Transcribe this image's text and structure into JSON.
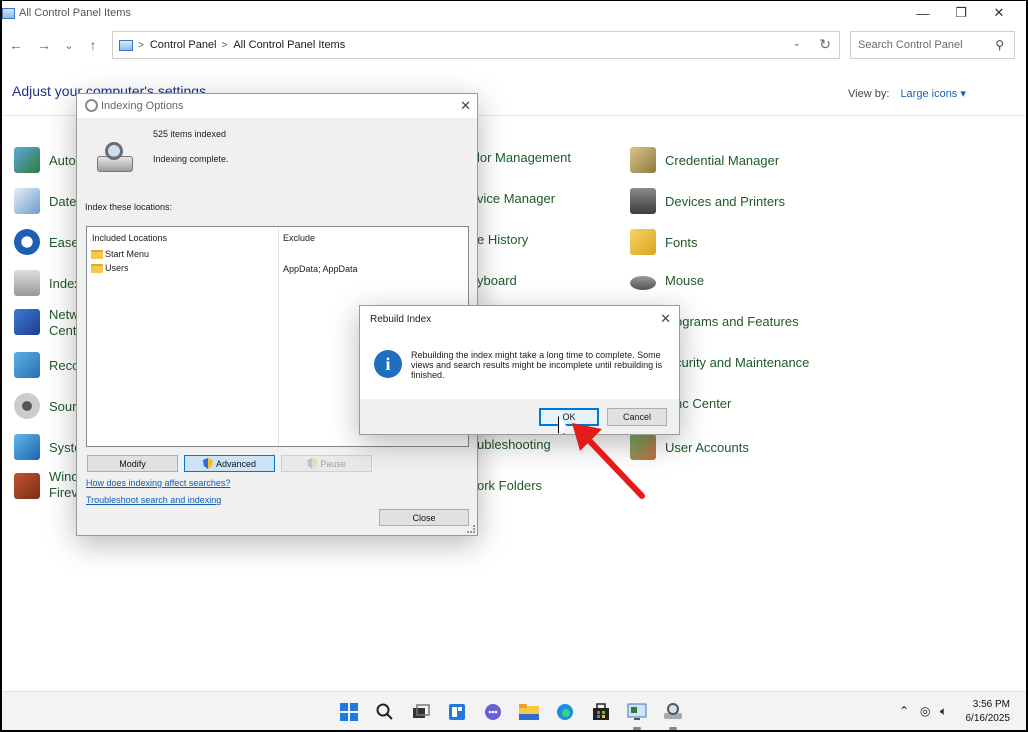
{
  "window": {
    "title": "All Control Panel Items",
    "minimize_glyph": "—",
    "maximize_glyph": "❐",
    "close_glyph": "✕"
  },
  "nav": {
    "back_glyph": "←",
    "forward_glyph": "→",
    "recent_glyph": "⌄",
    "up_glyph": "↑",
    "breadcrumb": [
      "Control Panel",
      "All Control Panel Items"
    ],
    "search_placeholder": "Search Control Panel"
  },
  "content": {
    "heading": "Adjust your computer's settings",
    "view_by_label": "View by:",
    "view_by_value": "Large icons ▾",
    "items_col1": [
      "Auto",
      "Date",
      "Ease",
      "Index",
      "Netw",
      "Cent",
      "Reco",
      "Sour",
      "Syste",
      "Wind",
      "Firev"
    ],
    "items_col2": [
      "lor Management",
      "vice Manager",
      "e History",
      "yboard",
      "ograms and Features",
      "curity and Maintenance",
      "nc Center",
      "ubleshooting",
      "ork Folders"
    ],
    "items_col3": [
      "Credential Manager",
      "Devices and Printers",
      "Fonts",
      "Mouse",
      "User Accounts"
    ]
  },
  "indexing_dialog": {
    "title": "Indexing Options",
    "count": "525 items indexed",
    "status": "Indexing complete.",
    "locations_label": "Index these locations:",
    "col_included": "Included Locations",
    "col_exclude": "Exclude",
    "locations": [
      {
        "name": "Start Menu",
        "exclude": ""
      },
      {
        "name": "Users",
        "exclude": "AppData; AppData"
      }
    ],
    "modify": "Modify",
    "advanced": "Advanced",
    "pause": "Pause",
    "link1": "How does indexing affect searches?",
    "link2": "Troubleshoot search and indexing",
    "close": "Close"
  },
  "rebuild_dialog": {
    "title": "Rebuild Index",
    "message": "Rebuilding the index might take a long time to complete. Some views and search results might be incomplete until rebuilding is finished.",
    "ok": "OK",
    "cancel": "Cancel"
  },
  "taskbar": {
    "time": "3:56 PM",
    "date": "6/16/2025"
  },
  "colors": {
    "arrow": "#e41b1b",
    "link": "#0b5cb5",
    "item_text": "#1f5a2b",
    "heading": "#1e3287"
  }
}
